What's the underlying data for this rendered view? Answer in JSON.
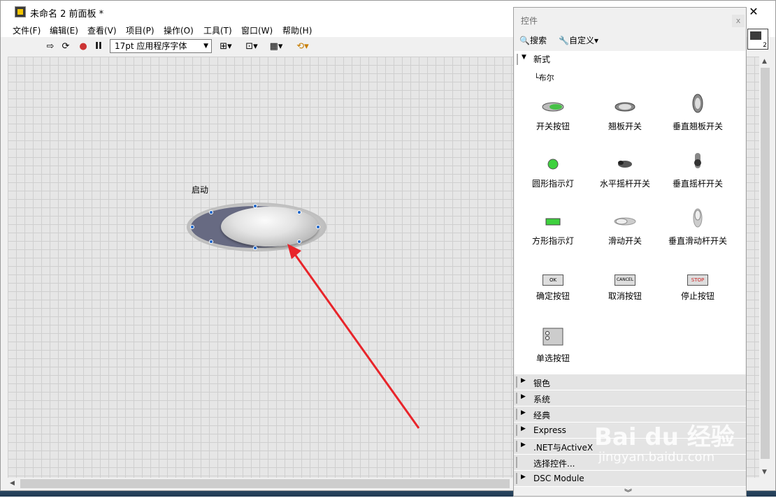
{
  "window": {
    "title": "未命名 2 前面板 *",
    "minimize": "—",
    "close": "✕"
  },
  "menu": [
    "文件(F)",
    "编辑(E)",
    "查看(V)",
    "项目(P)",
    "操作(O)",
    "工具(T)",
    "窗口(W)",
    "帮助(H)"
  ],
  "toolbar": {
    "font": "17pt 应用程序字体",
    "run_icon": "⇨",
    "loop_icon": "⟳",
    "abort_icon": "●",
    "pause_icon": "II"
  },
  "canvas": {
    "control_label": "启动"
  },
  "palette": {
    "title": "控件",
    "close": "x",
    "search": "搜索",
    "customize": "自定义▾",
    "category_open": "新式",
    "subcategory": "布尔",
    "items": [
      {
        "label": "开关按钮",
        "icon": "toggle-switch-icon"
      },
      {
        "label": "翘板开关",
        "icon": "rocker-switch-icon"
      },
      {
        "label": "垂直翘板开关",
        "icon": "vertical-rocker-icon"
      },
      {
        "label": "圆形指示灯",
        "icon": "round-led-icon"
      },
      {
        "label": "水平摇杆开关",
        "icon": "horizontal-toggle-icon"
      },
      {
        "label": "垂直摇杆开关",
        "icon": "vertical-toggle-icon"
      },
      {
        "label": "方形指示灯",
        "icon": "square-led-icon"
      },
      {
        "label": "滑动开关",
        "icon": "slide-switch-icon"
      },
      {
        "label": "垂直滑动杆开关",
        "icon": "vertical-slide-icon"
      },
      {
        "label": "确定按钮",
        "icon": "ok-button-icon",
        "text": "OK"
      },
      {
        "label": "取消按钮",
        "icon": "cancel-button-icon",
        "text": "CANCEL"
      },
      {
        "label": "停止按钮",
        "icon": "stop-button-icon",
        "text": "STOP"
      },
      {
        "label": "单选按钮",
        "icon": "radio-button-icon"
      }
    ],
    "categories": [
      "银色",
      "系统",
      "经典",
      "Express",
      ".NET与ActiveX",
      "选择控件...",
      "DSC Module"
    ],
    "more": "︾"
  },
  "side_icon": {
    "number": "2"
  },
  "watermark": {
    "brand": "Bai du 经验",
    "url": "jingyan.baidu.com"
  }
}
